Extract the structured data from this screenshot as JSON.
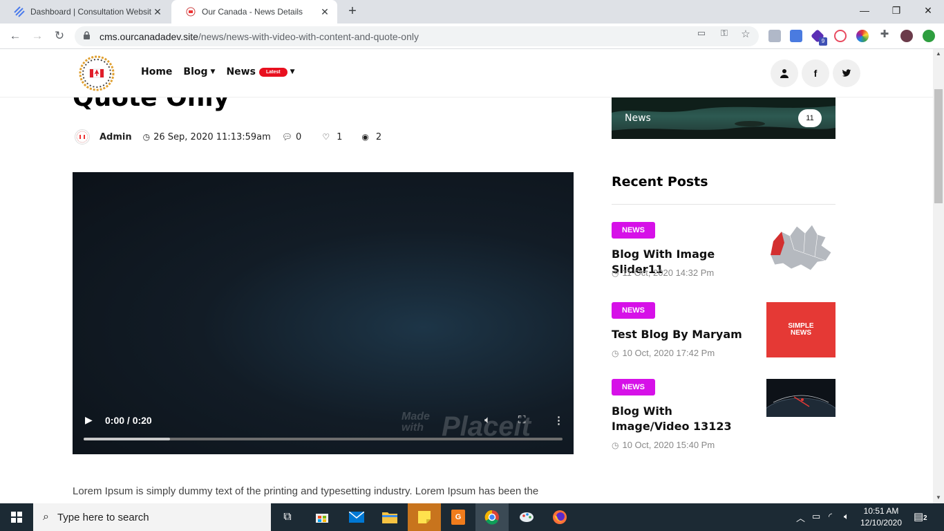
{
  "browser": {
    "tabs": [
      {
        "title": "Dashboard | Consultation Websit",
        "active": false
      },
      {
        "title": "Our Canada - News Details",
        "active": true
      }
    ],
    "url_host": "cms.ourcanadadev.site",
    "url_path": "/news/news-with-video-with-content-and-quote-only",
    "extension_badge": "9"
  },
  "header": {
    "nav": [
      {
        "label": "Home",
        "has_chevron": false
      },
      {
        "label": "Blog",
        "has_chevron": true
      },
      {
        "label": "News",
        "badge": "Latest",
        "has_chevron": true
      }
    ]
  },
  "post": {
    "title_fragment": "Quote Only",
    "author": "Admin",
    "date": "26 Sep, 2020 11:13:59am",
    "comments": "0",
    "likes": "1",
    "views": "2",
    "video": {
      "time": "0:00 / 0:20",
      "progress_fraction": 0.18,
      "watermark_small_1": "Made",
      "watermark_small_2": "with",
      "watermark_big": "Placeit"
    },
    "body_text": "Lorem Ipsum is simply dummy text of the printing and typesetting industry. Lorem Ipsum has been the"
  },
  "sidebar": {
    "category_card": {
      "name": "News",
      "count": "11"
    },
    "recent_title": "Recent Posts",
    "recent_posts": [
      {
        "tag": "NEWS",
        "title": "Blog With Image Slider11",
        "date": "11 Oct, 2020 14:32 Pm",
        "thumb": "canada-map"
      },
      {
        "tag": "NEWS",
        "title": "Test Blog By Maryam",
        "date": "10 Oct, 2020 17:42 Pm",
        "thumb": "simple-news",
        "thumb_text_1": "SIMPLE",
        "thumb_text_2": "NEWS"
      },
      {
        "tag": "NEWS",
        "title": "Blog With Image/Video 13123",
        "date": "10 Oct, 2020 15:40 Pm",
        "thumb": "dark-globe"
      }
    ]
  },
  "taskbar": {
    "search_placeholder": "Type here to search",
    "time": "10:51 AM",
    "date": "12/10/2020",
    "notifications": "2"
  },
  "colors": {
    "accent_tag": "#d611e8",
    "badge_red": "#e8101f",
    "thumb_red": "#e53935"
  }
}
